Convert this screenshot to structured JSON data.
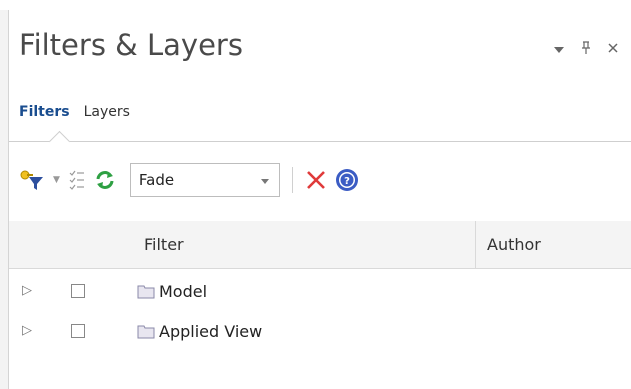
{
  "panel": {
    "title": "Filters & Layers",
    "buttons": {
      "dropdown": "▾",
      "pin": "ᵖ",
      "close": "×"
    }
  },
  "tabs": [
    {
      "label": "Filters",
      "active": true
    },
    {
      "label": "Layers",
      "active": false
    }
  ],
  "toolbar": {
    "fade_value": "Fade",
    "icons": [
      "add-filter-icon",
      "checklist-icon",
      "refresh-icon",
      "delete-icon",
      "help-icon"
    ]
  },
  "grid": {
    "columns": [
      "Filter",
      "Author"
    ],
    "rows": [
      {
        "label": "Model",
        "checked": false
      },
      {
        "label": "Applied View",
        "checked": false
      }
    ]
  },
  "colors": {
    "title": "#4a4a4a",
    "active_tab": "#1a4d8f",
    "delete": "#e03a3a",
    "help": "#3b5cc4",
    "refresh": "#2ea043"
  }
}
